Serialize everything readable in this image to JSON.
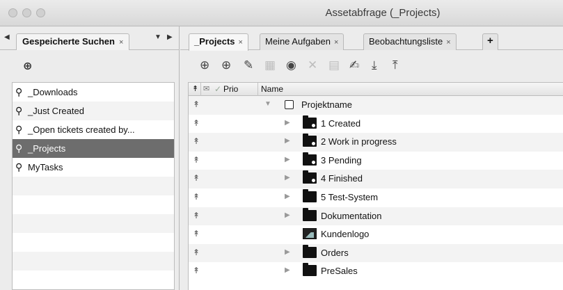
{
  "window": {
    "title": "Assetabfrage (_Projects)"
  },
  "left": {
    "tab": {
      "label": "Gespeicherte Suchen",
      "close": "×"
    },
    "nav": {
      "prev": "◀",
      "menu": "▼",
      "next": "▶"
    },
    "add_icon": "plus-circle-icon",
    "saved_searches": [
      {
        "label": "_Downloads",
        "selected": false
      },
      {
        "label": "_Just Created",
        "selected": false
      },
      {
        "label": "_Open tickets created by...",
        "selected": false
      },
      {
        "label": "_Projects",
        "selected": true
      },
      {
        "label": "MyTasks",
        "selected": false
      }
    ]
  },
  "right": {
    "tabs": [
      {
        "label": "_Projects",
        "close": "×",
        "active": true
      },
      {
        "label": "Meine Aufgaben",
        "close": "×",
        "active": false
      },
      {
        "label": "Beobachtungsliste",
        "close": "×",
        "active": false
      }
    ],
    "new_tab": "+",
    "toolbar": [
      "add-menu-icon",
      "add-icon",
      "edit-icon",
      "duplicate-icon",
      "view-icon",
      "delete-icon",
      "save-icon",
      "rename-icon",
      "import-icon",
      "export-icon"
    ],
    "columns": {
      "prio": "Prio",
      "name": "Name"
    },
    "rows": [
      {
        "label": "Projektname",
        "type": "checkbox",
        "expanded": true,
        "level": 0
      },
      {
        "label": "1 Created",
        "type": "smart-folder",
        "level": 1
      },
      {
        "label": "2 Work in progress",
        "type": "smart-folder",
        "level": 1
      },
      {
        "label": "3 Pending",
        "type": "smart-folder",
        "level": 1
      },
      {
        "label": "4 Finished",
        "type": "smart-folder",
        "level": 1
      },
      {
        "label": "5 Test-System",
        "type": "folder",
        "level": 1
      },
      {
        "label": "Dokumentation",
        "type": "folder",
        "level": 1
      },
      {
        "label": "Kundenlogo",
        "type": "image",
        "level": 1
      },
      {
        "label": "Orders",
        "type": "folder",
        "level": 1
      },
      {
        "label": "PreSales",
        "type": "folder",
        "level": 1
      }
    ]
  }
}
